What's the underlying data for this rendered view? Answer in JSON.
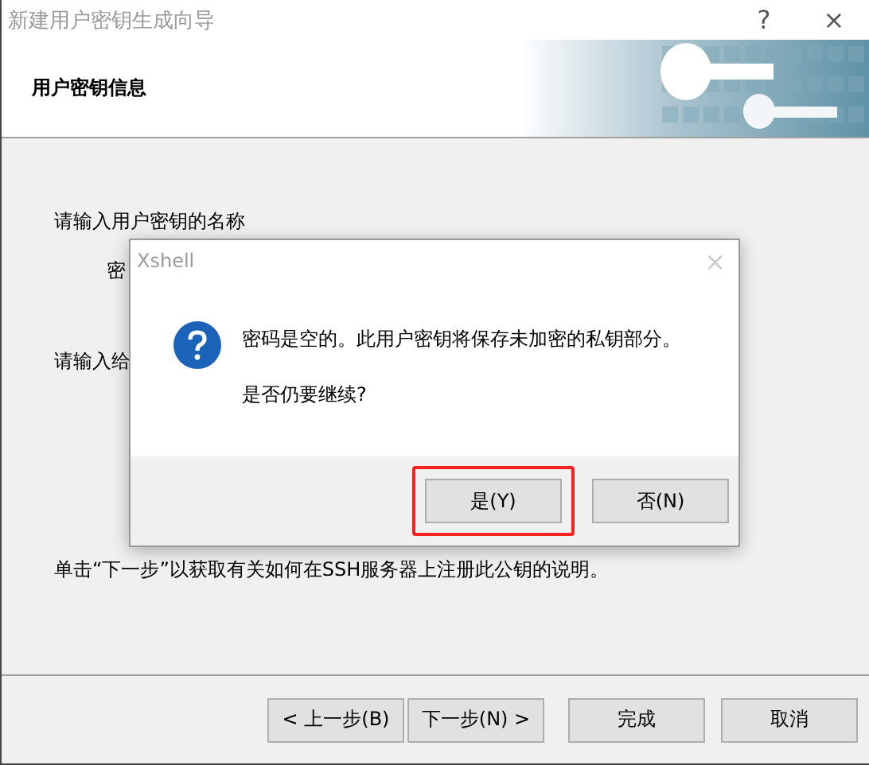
{
  "window": {
    "title": "新建用户密钥生成向导",
    "help": "?",
    "close": "×"
  },
  "header": {
    "title": "用户密钥信息"
  },
  "body": {
    "labels": [
      "请输入用户密钥的名称",
      "密",
      "请输入给"
    ],
    "instruction": "单击“下一步”以获取有关如何在SSH服务器上注册此公钥的说明。"
  },
  "dialog": {
    "title": "Xshell",
    "close": "×",
    "message": "密码是空的。此用户密钥将保存未加密的私钥部分。",
    "question": "是否仍要继续?",
    "buttons": [
      {
        "label": "是(Y)",
        "highlighted": true
      },
      {
        "label": "否(N)",
        "highlighted": false
      }
    ]
  },
  "buttons": [
    {
      "label": "< 上一步(B)"
    },
    {
      "label": "下一步(N) >"
    },
    {
      "label": "完成"
    },
    {
      "label": "取消"
    }
  ]
}
